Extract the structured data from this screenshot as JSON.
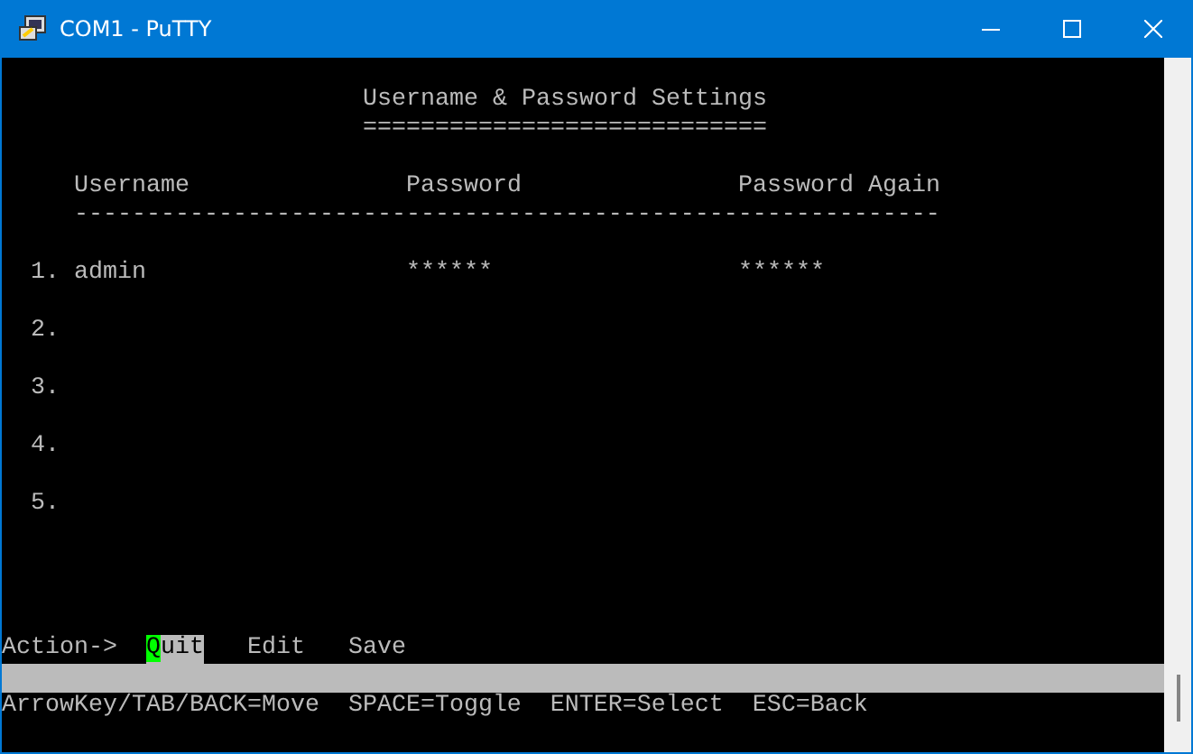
{
  "window": {
    "title": "COM1 - PuTTY"
  },
  "terminal": {
    "heading": "Username & Password Settings",
    "heading_underline": "============================",
    "columns": [
      "Username",
      "Password",
      "Password Again"
    ],
    "header_rule": "------------------------------------------------------------",
    "rows": [
      {
        "number": "1.",
        "username": "admin",
        "password": "******",
        "password_again": "******"
      },
      {
        "number": "2."
      },
      {
        "number": "3."
      },
      {
        "number": "4."
      },
      {
        "number": "5."
      }
    ],
    "action_prompt": "Action->",
    "actions": [
      {
        "label": "Quit",
        "selected": true
      },
      {
        "label": "Edit",
        "selected": false
      },
      {
        "label": "Save",
        "selected": false
      }
    ],
    "help": "ArrowKey/TAB/BACK=Move  SPACE=Toggle  ENTER=Select  ESC=Back"
  }
}
